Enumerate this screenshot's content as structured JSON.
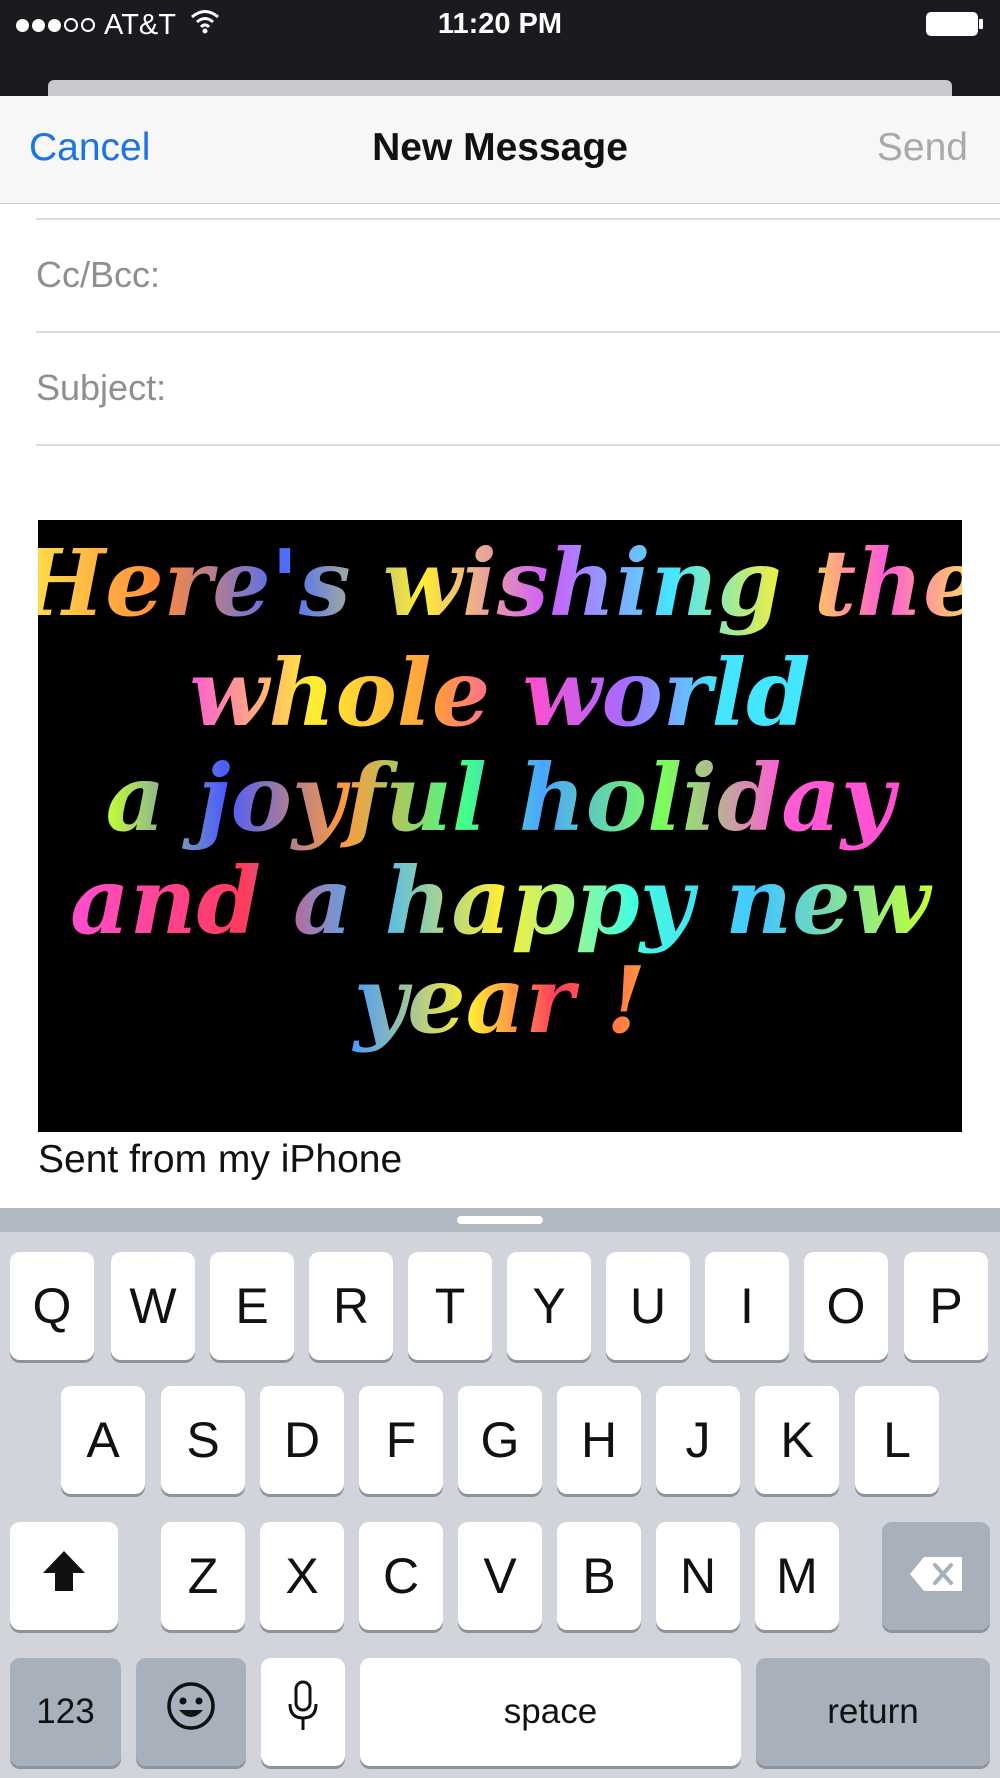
{
  "status_bar": {
    "carrier": "AT&T",
    "signal_icon": "signal-dots-icon",
    "wifi_icon": "wifi-icon",
    "time": "11:20 PM",
    "battery_icon": "battery-full-icon"
  },
  "nav": {
    "cancel": "Cancel",
    "title": "New Message",
    "send": "Send"
  },
  "fields": {
    "cc_bcc": "Cc/Bcc:",
    "subject": "Subject:"
  },
  "greeting_card": {
    "lines": [
      "Here's wishing the",
      "whole world",
      "a joyful holiday",
      "and a happy new",
      "year !"
    ]
  },
  "body": {
    "signature": "Sent from my iPhone"
  },
  "keyboard": {
    "row1": [
      "Q",
      "W",
      "E",
      "R",
      "T",
      "Y",
      "U",
      "I",
      "O",
      "P"
    ],
    "row2": [
      "A",
      "S",
      "D",
      "F",
      "G",
      "H",
      "J",
      "K",
      "L"
    ],
    "row3": [
      "Z",
      "X",
      "C",
      "V",
      "B",
      "N",
      "M"
    ],
    "numbers": "123",
    "space": "space",
    "return": "return",
    "shift_icon": "shift-icon",
    "delete_icon": "delete-icon",
    "emoji_icon": "emoji-icon",
    "mic_icon": "microphone-icon"
  },
  "colors": {
    "accent": "#1a73e8",
    "send_disabled": "#a9a9ad"
  }
}
